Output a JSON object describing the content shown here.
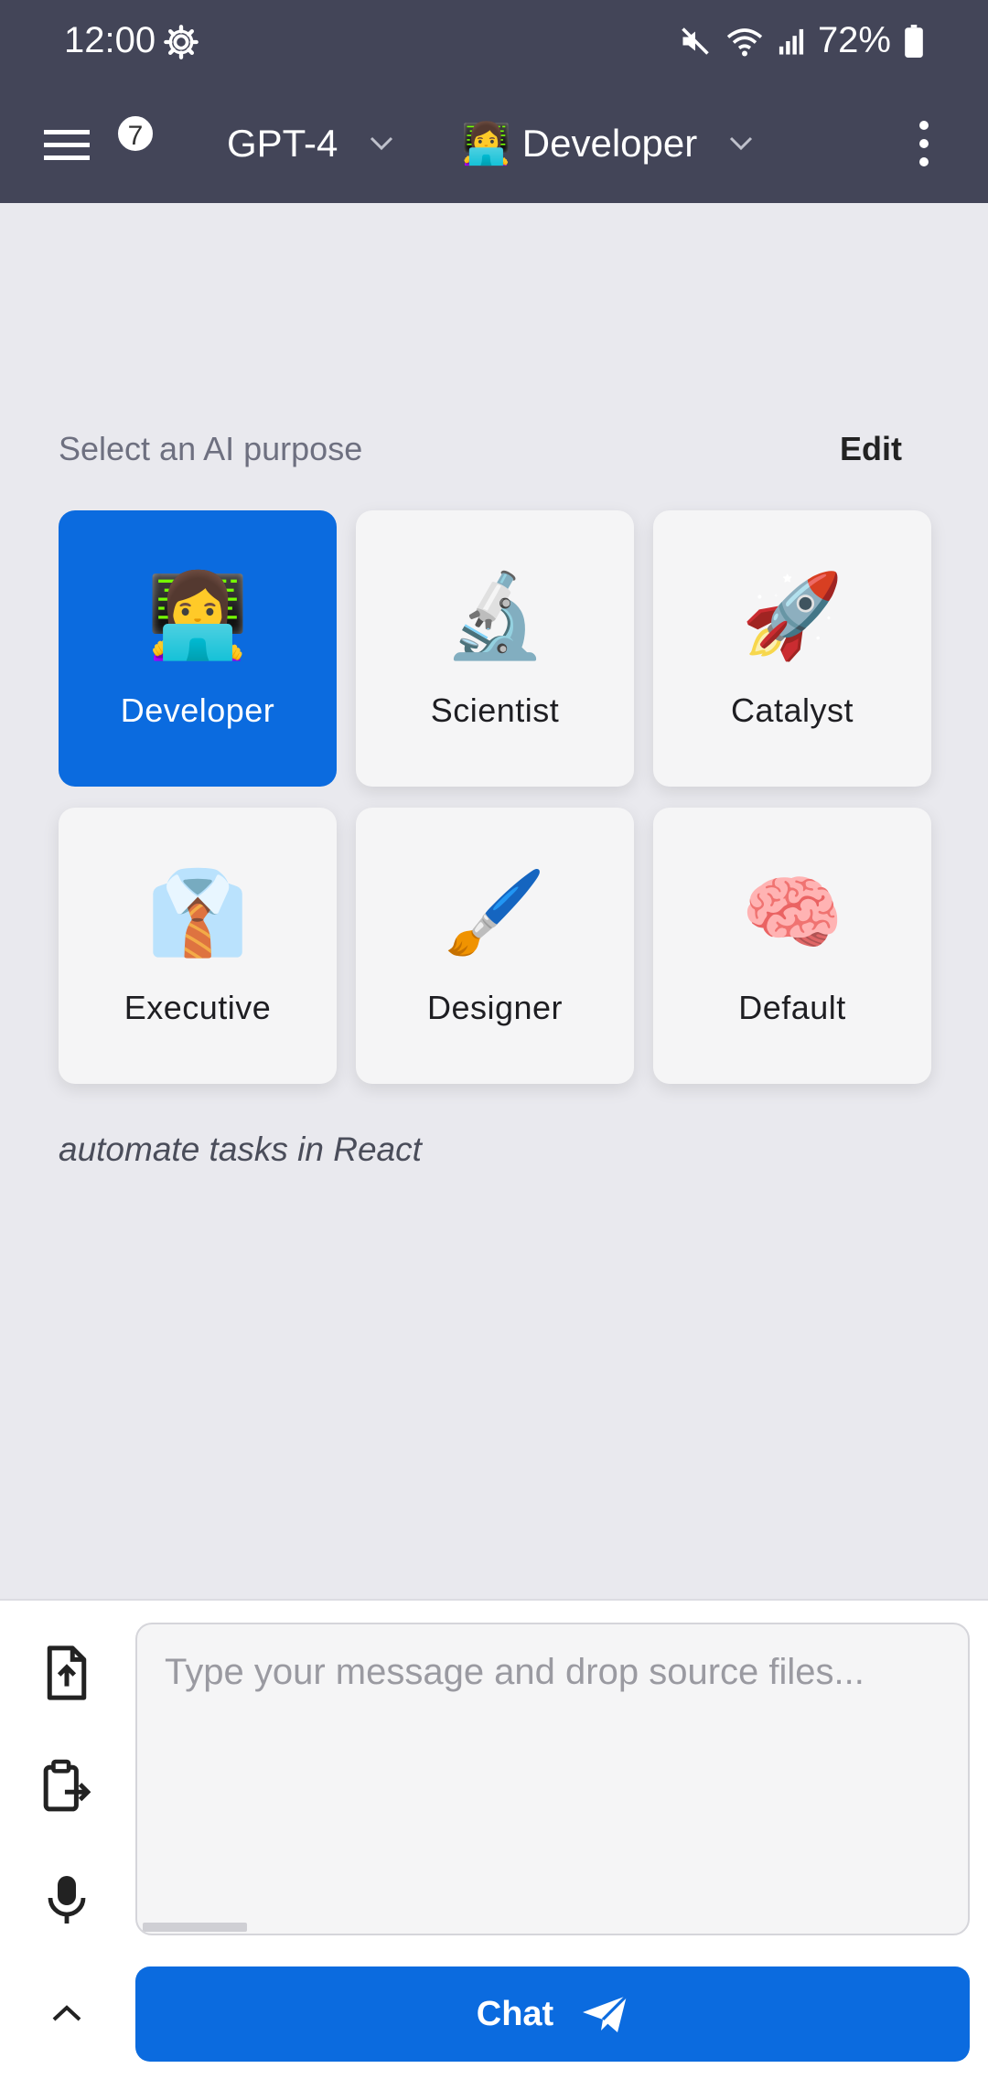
{
  "status_bar": {
    "time": "12:00",
    "battery": "72%",
    "icons": [
      "gear-icon",
      "mute-icon",
      "wifi-icon",
      "signal-icon",
      "battery-icon"
    ]
  },
  "app_bar": {
    "menu_badge": "7",
    "model": "GPT-4",
    "persona": "Developer",
    "persona_emoji": "👩‍💻"
  },
  "purpose": {
    "label": "Select an AI purpose",
    "edit_label": "Edit",
    "selected": "Developer",
    "tiles": [
      {
        "label": "Developer",
        "emoji": "👩‍💻"
      },
      {
        "label": "Scientist",
        "emoji": "🔬"
      },
      {
        "label": "Catalyst",
        "emoji": "🚀"
      },
      {
        "label": "Executive",
        "emoji": "👔"
      },
      {
        "label": "Designer",
        "emoji": "🖌️"
      },
      {
        "label": "Default",
        "emoji": "🧠"
      }
    ],
    "tagline": "automate tasks in React"
  },
  "composer": {
    "placeholder": "Type your message and drop source files...",
    "value": "",
    "chat_label": "Chat"
  },
  "colors": {
    "header_bg": "#434558",
    "accent": "#0b6bdf",
    "page_bg": "#e9e9ee"
  }
}
